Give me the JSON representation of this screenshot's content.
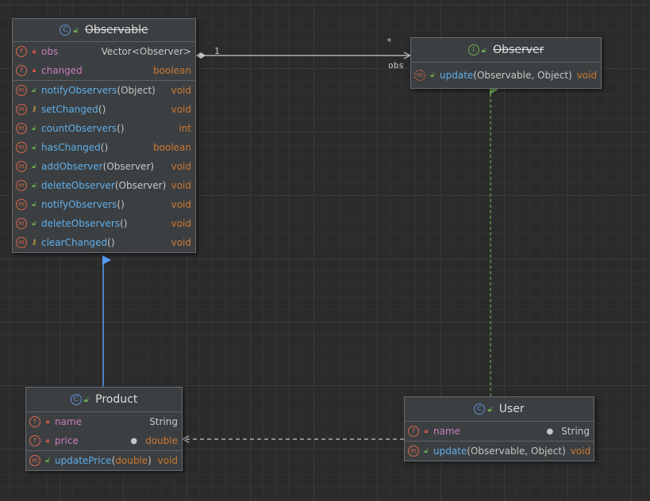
{
  "colors": {
    "background": "#2b2b2b",
    "node_bg": "#3c3f41",
    "field_name": "#c77dbb",
    "method_name": "#5eaeea",
    "primitive_type": "#cc7832",
    "badge": "#d9684c",
    "class_icon": "#5e8fd8",
    "interface_icon": "#6aa84f",
    "aggregation_line": "#c8c8c8",
    "inheritance_line": "#589df6",
    "realization_line": "#6aa84f",
    "dependency_line": "#c8c8c8"
  },
  "observable": {
    "title": "Observable",
    "kind_icon": "C",
    "fields": [
      {
        "badge": "f",
        "visibility": "private",
        "name": "obs",
        "type": "Vector<Observer>"
      },
      {
        "badge": "f",
        "visibility": "private",
        "name": "changed",
        "type": "boolean"
      }
    ],
    "methods": [
      {
        "badge": "m",
        "visibility": "public",
        "name": "notifyObservers",
        "params": "(Object)",
        "type": "void"
      },
      {
        "badge": "m",
        "visibility": "protected",
        "name": "setChanged",
        "params": "()",
        "type": "void"
      },
      {
        "badge": "m",
        "visibility": "public",
        "name": "countObservers",
        "params": "()",
        "type": "int"
      },
      {
        "badge": "m",
        "visibility": "public",
        "name": "hasChanged",
        "params": "()",
        "type": "boolean"
      },
      {
        "badge": "m",
        "visibility": "public",
        "name": "addObserver",
        "params": "(Observer)",
        "type": "void"
      },
      {
        "badge": "m",
        "visibility": "public",
        "name": "deleteObserver",
        "params": "(Observer)",
        "type": "void"
      },
      {
        "badge": "m",
        "visibility": "public",
        "name": "notifyObservers",
        "params": "()",
        "type": "void"
      },
      {
        "badge": "m",
        "visibility": "public",
        "name": "deleteObservers",
        "params": "()",
        "type": "void"
      },
      {
        "badge": "m",
        "visibility": "protected",
        "name": "clearChanged",
        "params": "()",
        "type": "void"
      }
    ]
  },
  "observer": {
    "title": "Observer",
    "kind_icon": "I",
    "methods": [
      {
        "badge": "m",
        "visibility": "public",
        "name": "update",
        "params": "(Observable, Object)",
        "type": "void"
      }
    ]
  },
  "product": {
    "title": "Product",
    "kind_icon": "C",
    "fields": [
      {
        "badge": "f",
        "visibility": "private",
        "name": "name",
        "type": "String"
      },
      {
        "badge": "f",
        "visibility": "private",
        "name": "price",
        "type": "double"
      }
    ],
    "methods": [
      {
        "badge": "m",
        "visibility": "public",
        "name": "updatePrice",
        "params_kw": "double",
        "type": "void"
      }
    ]
  },
  "user": {
    "title": "User",
    "kind_icon": "C",
    "fields": [
      {
        "badge": "f",
        "visibility": "private",
        "name": "name",
        "type": "String"
      }
    ],
    "methods": [
      {
        "badge": "m",
        "visibility": "public",
        "name": "update",
        "params": "(Observable, Object)",
        "type": "void"
      }
    ]
  },
  "edges": {
    "aggregation_source_multiplicity": "1",
    "aggregation_target_multiplicity": "*",
    "aggregation_role": "obs"
  }
}
